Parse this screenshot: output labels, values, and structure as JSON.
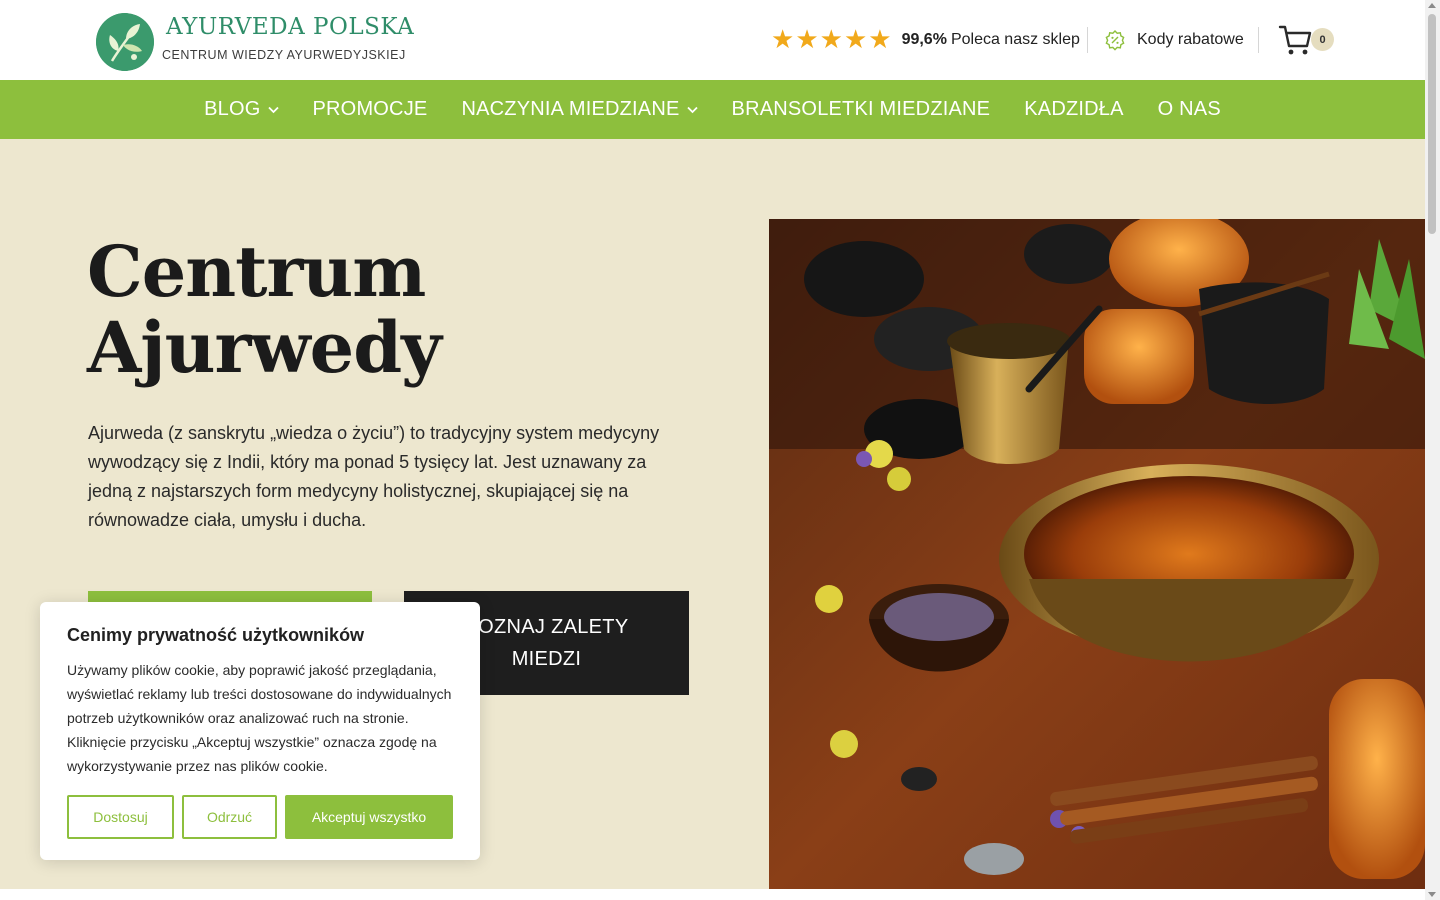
{
  "header": {
    "logo_title": "AYURVEDA POLSKA",
    "logo_subtitle": "CENTRUM WIEDZY AYURWEDYJSKIEJ",
    "rating_stars": 5,
    "rating_value": "99,6%",
    "rating_text": "Poleca nasz sklep",
    "coupon_label": "Kody rabatowe",
    "cart_count": "0"
  },
  "nav": {
    "items": [
      {
        "label": "BLOG",
        "dropdown": true
      },
      {
        "label": "PROMOCJE",
        "dropdown": false
      },
      {
        "label": "NACZYNIA MIEDZIANE",
        "dropdown": true
      },
      {
        "label": "BRANSOLETKI MIEDZIANE",
        "dropdown": false
      },
      {
        "label": "KADZIDŁA",
        "dropdown": false
      },
      {
        "label": "O NAS",
        "dropdown": false
      }
    ]
  },
  "hero": {
    "title_line1": "Centrum",
    "title_line2": "Ajurwedy",
    "text": "Ajurweda (z sanskrytu „wiedza o życiu”) to tradycyjny system medycyny wywodzący się z Indii, który ma ponad 5 tysięcy lat. Jest uznawany za jedną z najstarszych form medycyny holistycznej, skupiającej się na równowadze ciała, umysłu i ducha.",
    "secondary_button": "POZNAJ ZALETY MIEDZI"
  },
  "cookie": {
    "title": "Cenimy prywatność użytkowników",
    "text": "Używamy plików cookie, aby poprawić jakość przeglądania, wyświetlać reklamy lub treści dostosowane do indywidualnych potrzeb użytkowników oraz analizować ruch na stronie. Kliknięcie przycisku „Akceptuj wszystkie” oznacza zgodę na wykorzystywanie przez nas plików cookie.",
    "customize_label": "Dostosuj",
    "reject_label": "Odrzuć",
    "accept_label": "Akceptuj wszystko"
  },
  "colors": {
    "brand_green": "#8dbf3d",
    "logo_green": "#2f8d69",
    "hero_bg": "#ede7cf",
    "star": "#f1a91b",
    "dark_button": "#1e1e1e"
  },
  "icons": [
    "logo-leaf-icon",
    "star-icon",
    "coupon-icon",
    "cart-icon",
    "chevron-down-icon"
  ]
}
